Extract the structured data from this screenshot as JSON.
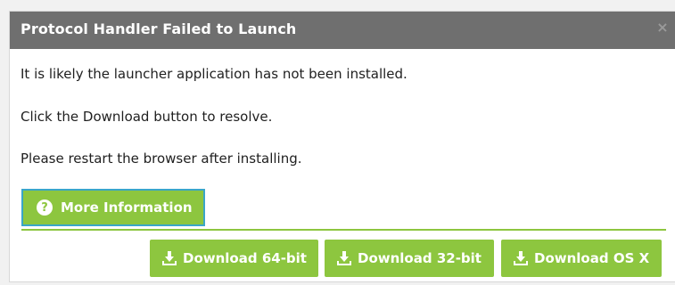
{
  "dialog": {
    "title": "Protocol Handler Failed to Launch",
    "close_label": "×",
    "messages": [
      "It is likely the launcher application has not been installed.",
      "Click the Download button to resolve.",
      "Please restart the browser after installing."
    ],
    "more_info_button": {
      "icon": "question-circle-icon",
      "label": "More Information"
    },
    "download_buttons": [
      {
        "icon": "download-icon",
        "label": "Download 64-bit"
      },
      {
        "icon": "download-icon",
        "label": "Download 32-bit"
      },
      {
        "icon": "download-icon",
        "label": "Download OS X"
      }
    ]
  },
  "colors": {
    "titlebar": "#6f6f6f",
    "accent_green": "#8dc63f",
    "focus_outline": "#3aa6c9",
    "background": "#f1f1f1"
  }
}
